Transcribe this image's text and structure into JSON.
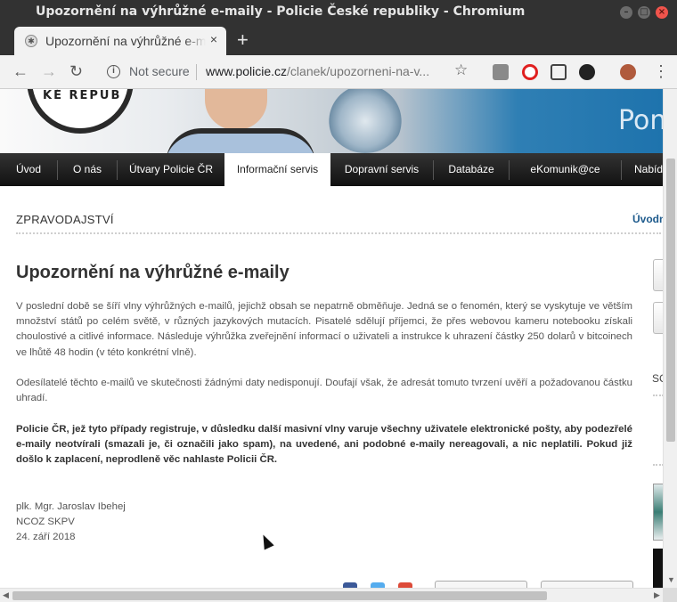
{
  "window": {
    "title": "Upozornění na výhrůžné e-maily - Policie České republiky - Chromium",
    "controls": {
      "minimize": "–",
      "maximize": "□",
      "close": "×"
    }
  },
  "tab": {
    "title": "Upozornění na výhrůžné e-maily - Policie České republiky",
    "close": "×"
  },
  "new_tab": "+",
  "toolbar": {
    "back": "←",
    "forward": "→",
    "reload": "↻",
    "info": "i",
    "security": "Not secure",
    "url_host": "www.policie.cz",
    "url_path": "/clanek/upozorneni-na-v...",
    "star": "☆",
    "menu": "⋮"
  },
  "banner": {
    "seal_text": "KÉ REPUB",
    "tagline": "Pom"
  },
  "nav": {
    "items": [
      "Úvod",
      "O nás",
      "Útvary Policie ČR",
      "Informační servis",
      "Dopravní servis",
      "Databáze",
      "eKomunik@ce",
      "Nabíd"
    ],
    "active": "Informační servis"
  },
  "section": {
    "heading": "ZPRAVODAJSTVÍ",
    "breadcrumb": "Úvodn"
  },
  "article": {
    "title": "Upozornění na výhrůžné e-maily",
    "paragraphs": [
      "V poslední době se šíří vlny výhrůžných e-mailů, jejichž obsah se nepatrně obměňuje. Jedná se o fenomén, který se vyskytuje ve větším množství států po celém světě, v různých jazykových mutacích. Pisatelé sdělují příjemci, že přes webovou kameru notebooku získali choulostivé a citlivé informace. Následuje výhrůžka zveřejnění informací o uživateli a instrukce k uhrazení částky 250 dolarů v bitcoinech ve lhůtě 48 hodin (v této konkrétní vlně).",
      "Odesílatelé těchto e-mailů ve skutečnosti žádnými daty nedisponují. Doufají však, že adresát tomuto tvrzení uvěří a požadovanou částku uhradí.",
      "Policie ČR, jež tyto případy registruje, v důsledku další masivní vlny varuje všechny uživatele elektronické pošty, aby podezřelé e-maily neotvírali (smazali je, či označili jako spam), na uvedené, ani podobné e-maily nereagovali, a nic neplatili. Pokud již došlo k zaplacení, neprodleně věc nahlaste Policii ČR."
    ],
    "signature": [
      "plk. Mgr. Jaroslav Ibehej",
      "NCOZ SKPV",
      "24. září 2018"
    ]
  },
  "sidebar": {
    "so_label": "SC"
  },
  "colors": {
    "nav_bg": "#1a1a1a",
    "link": "#1d5a8c",
    "titlebar": "#323232",
    "close_button": "#f0544c"
  }
}
